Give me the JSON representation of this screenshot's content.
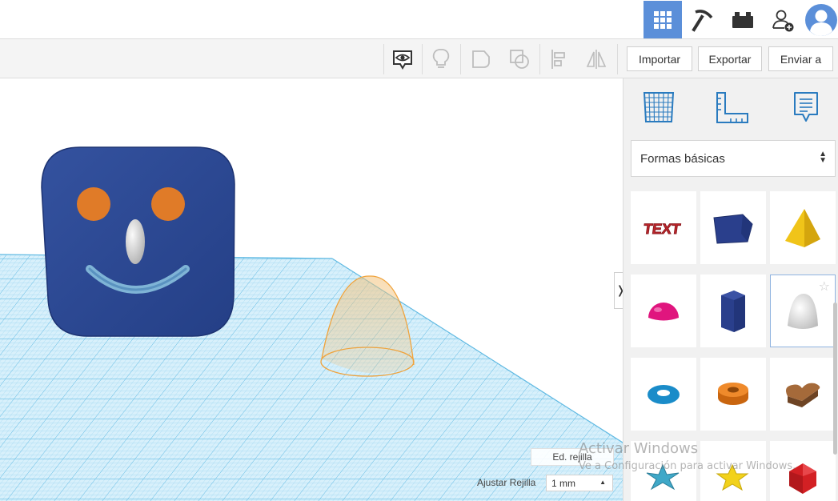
{
  "topbar": {
    "icons": [
      "grid-view-icon",
      "pickaxe-icon",
      "brick-icon",
      "add-user-icon",
      "user-avatar"
    ]
  },
  "toolbar": {
    "tools": [
      "show-icon",
      "lightbulb-icon",
      "group-shape-icon",
      "ungroup-shape-icon",
      "align-icon",
      "mirror-icon"
    ],
    "import_label": "Importar",
    "export_label": "Exportar",
    "send_label": "Enviar a"
  },
  "panel": {
    "view_icons": [
      "workplane-grid-icon",
      "ruler-icon",
      "notes-icon"
    ],
    "category": "Formas básicas",
    "shapes": [
      "text-shape",
      "box-shape",
      "pyramid-shape",
      "half-sphere-shape",
      "polygon-shape",
      "paraboloid-shape",
      "torus-shape",
      "tube-shape",
      "heart-shape",
      "starfish-shape",
      "star-shape",
      "icosahedron-shape"
    ]
  },
  "workplane": {
    "edit_grid_label": "Ed. rejilla",
    "snap_label": "Ajustar Rejilla",
    "snap_value": "1 mm"
  },
  "watermark": {
    "line1": "Activar Windows",
    "line2": "Ve a Configuración para activar Windows."
  },
  "colors": {
    "accent": "#5b8fd9",
    "grid": "#64bde6",
    "face_blue": "#2e4a96",
    "face_orange": "#e07b28",
    "hole_outline": "#f0a33c"
  }
}
